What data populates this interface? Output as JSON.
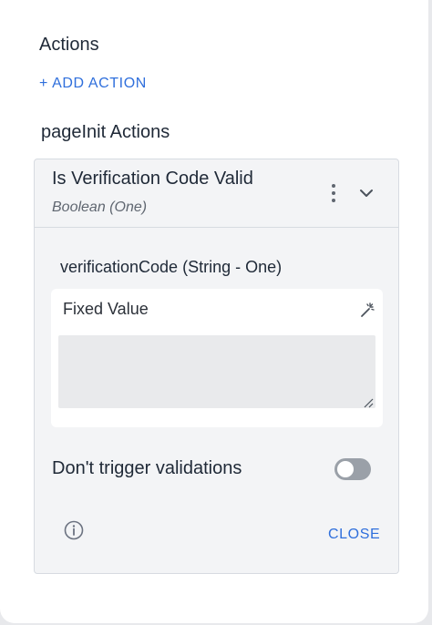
{
  "actions": {
    "title": "Actions",
    "add_action_label": "+ ADD ACTION"
  },
  "page_init": {
    "title": "pageInit Actions",
    "action": {
      "title": "Is Verification Code Valid",
      "subtitle": "Boolean (One)",
      "more_icon": "more-vertical-icon",
      "expand_icon": "chevron-down-icon",
      "parameter": {
        "label": "verificationCode (String - One)",
        "mode": "Fixed Value",
        "mode_icon": "magic-wand-icon",
        "value": ""
      },
      "toggle": {
        "label": "Don't trigger validations",
        "on": false
      },
      "info_icon": "info-icon",
      "close_label": "CLOSE"
    }
  },
  "colors": {
    "accent": "#2f6fdc",
    "text": "#1f2937",
    "card_bg": "#f3f4f6",
    "toggle_off": "#9aa0a8"
  }
}
